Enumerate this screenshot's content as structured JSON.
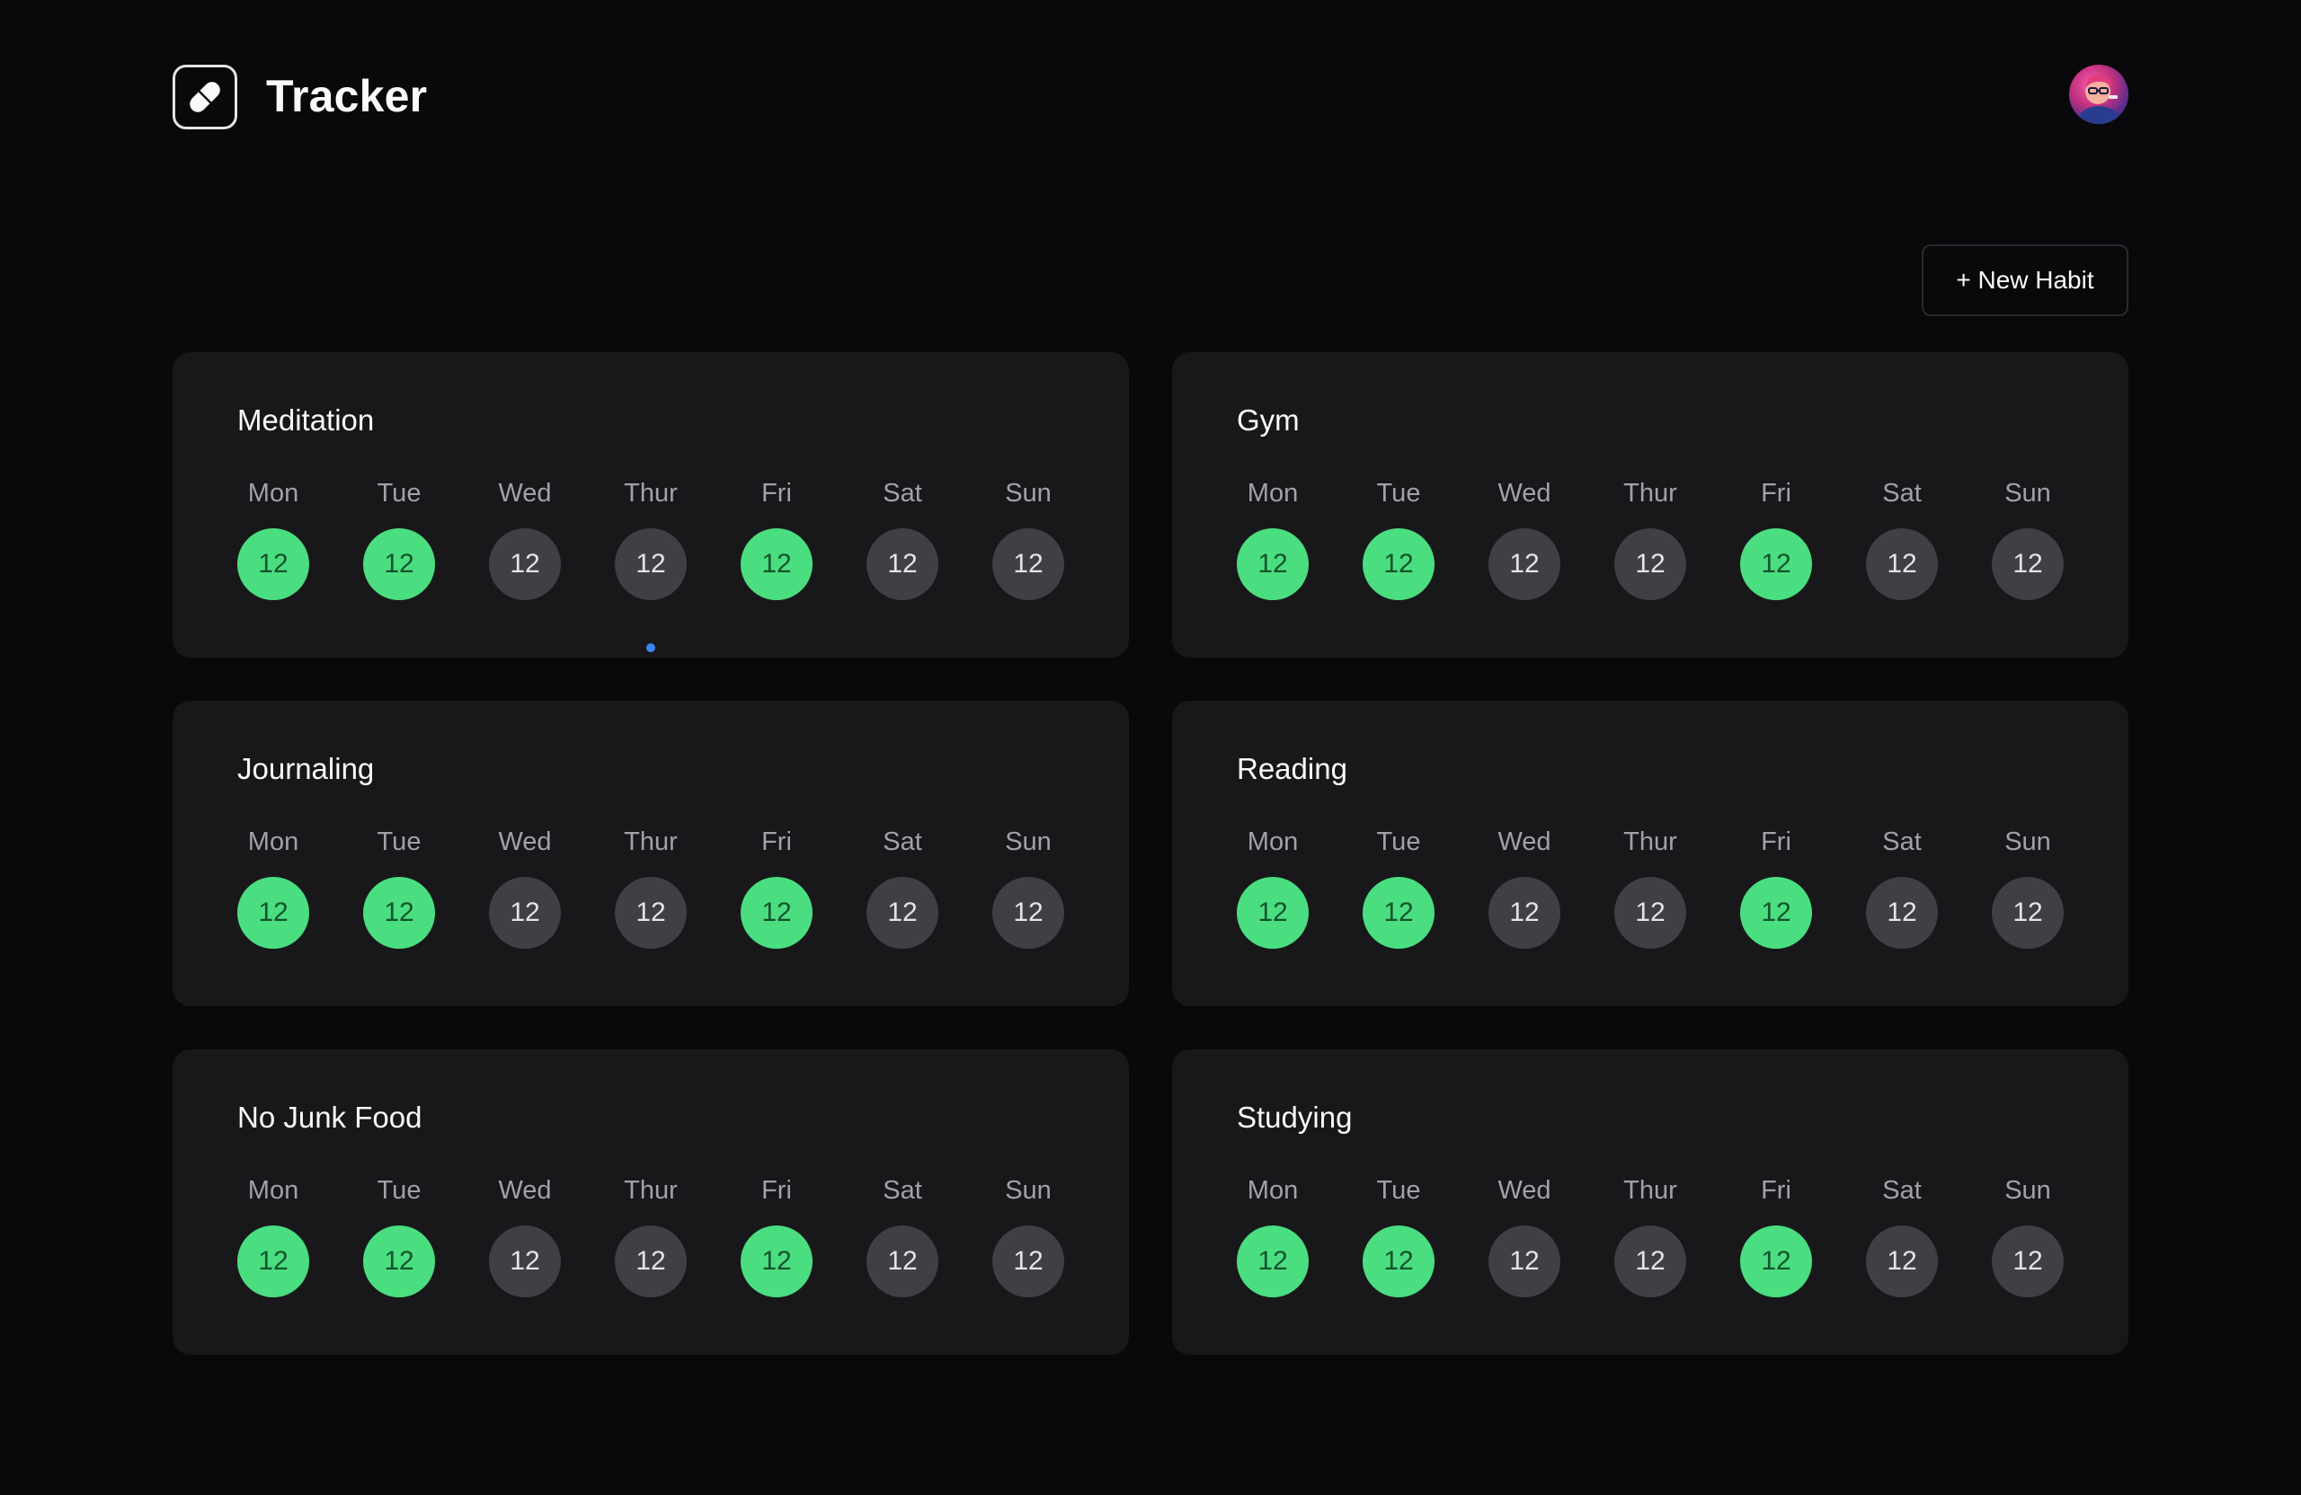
{
  "app": {
    "title": "Tracker",
    "logo_icon": "pill-icon",
    "avatar_icon": "user-avatar"
  },
  "toolbar": {
    "new_habit_label": "+ New Habit"
  },
  "colors": {
    "background": "#09090b",
    "card": "#18181b",
    "done": "#4ade80",
    "todo": "#3f3f46",
    "today_indicator": "#3b82f6"
  },
  "habits": [
    {
      "name": "Meditation",
      "days": [
        {
          "label": "Mon",
          "value": "12",
          "done": true
        },
        {
          "label": "Tue",
          "value": "12",
          "done": true
        },
        {
          "label": "Wed",
          "value": "12",
          "done": false
        },
        {
          "label": "Thur",
          "value": "12",
          "done": false,
          "today": true
        },
        {
          "label": "Fri",
          "value": "12",
          "done": true
        },
        {
          "label": "Sat",
          "value": "12",
          "done": false
        },
        {
          "label": "Sun",
          "value": "12",
          "done": false
        }
      ]
    },
    {
      "name": "Gym",
      "days": [
        {
          "label": "Mon",
          "value": "12",
          "done": true
        },
        {
          "label": "Tue",
          "value": "12",
          "done": true
        },
        {
          "label": "Wed",
          "value": "12",
          "done": false
        },
        {
          "label": "Thur",
          "value": "12",
          "done": false
        },
        {
          "label": "Fri",
          "value": "12",
          "done": true
        },
        {
          "label": "Sat",
          "value": "12",
          "done": false
        },
        {
          "label": "Sun",
          "value": "12",
          "done": false
        }
      ]
    },
    {
      "name": "Journaling",
      "days": [
        {
          "label": "Mon",
          "value": "12",
          "done": true
        },
        {
          "label": "Tue",
          "value": "12",
          "done": true
        },
        {
          "label": "Wed",
          "value": "12",
          "done": false
        },
        {
          "label": "Thur",
          "value": "12",
          "done": false
        },
        {
          "label": "Fri",
          "value": "12",
          "done": true
        },
        {
          "label": "Sat",
          "value": "12",
          "done": false
        },
        {
          "label": "Sun",
          "value": "12",
          "done": false
        }
      ]
    },
    {
      "name": "Reading",
      "days": [
        {
          "label": "Mon",
          "value": "12",
          "done": true
        },
        {
          "label": "Tue",
          "value": "12",
          "done": true
        },
        {
          "label": "Wed",
          "value": "12",
          "done": false
        },
        {
          "label": "Thur",
          "value": "12",
          "done": false
        },
        {
          "label": "Fri",
          "value": "12",
          "done": true
        },
        {
          "label": "Sat",
          "value": "12",
          "done": false
        },
        {
          "label": "Sun",
          "value": "12",
          "done": false
        }
      ]
    },
    {
      "name": "No Junk Food",
      "days": [
        {
          "label": "Mon",
          "value": "12",
          "done": true
        },
        {
          "label": "Tue",
          "value": "12",
          "done": true
        },
        {
          "label": "Wed",
          "value": "12",
          "done": false
        },
        {
          "label": "Thur",
          "value": "12",
          "done": false
        },
        {
          "label": "Fri",
          "value": "12",
          "done": true
        },
        {
          "label": "Sat",
          "value": "12",
          "done": false
        },
        {
          "label": "Sun",
          "value": "12",
          "done": false
        }
      ]
    },
    {
      "name": "Studying",
      "days": [
        {
          "label": "Mon",
          "value": "12",
          "done": true
        },
        {
          "label": "Tue",
          "value": "12",
          "done": true
        },
        {
          "label": "Wed",
          "value": "12",
          "done": false
        },
        {
          "label": "Thur",
          "value": "12",
          "done": false
        },
        {
          "label": "Fri",
          "value": "12",
          "done": true
        },
        {
          "label": "Sat",
          "value": "12",
          "done": false
        },
        {
          "label": "Sun",
          "value": "12",
          "done": false
        }
      ]
    }
  ]
}
